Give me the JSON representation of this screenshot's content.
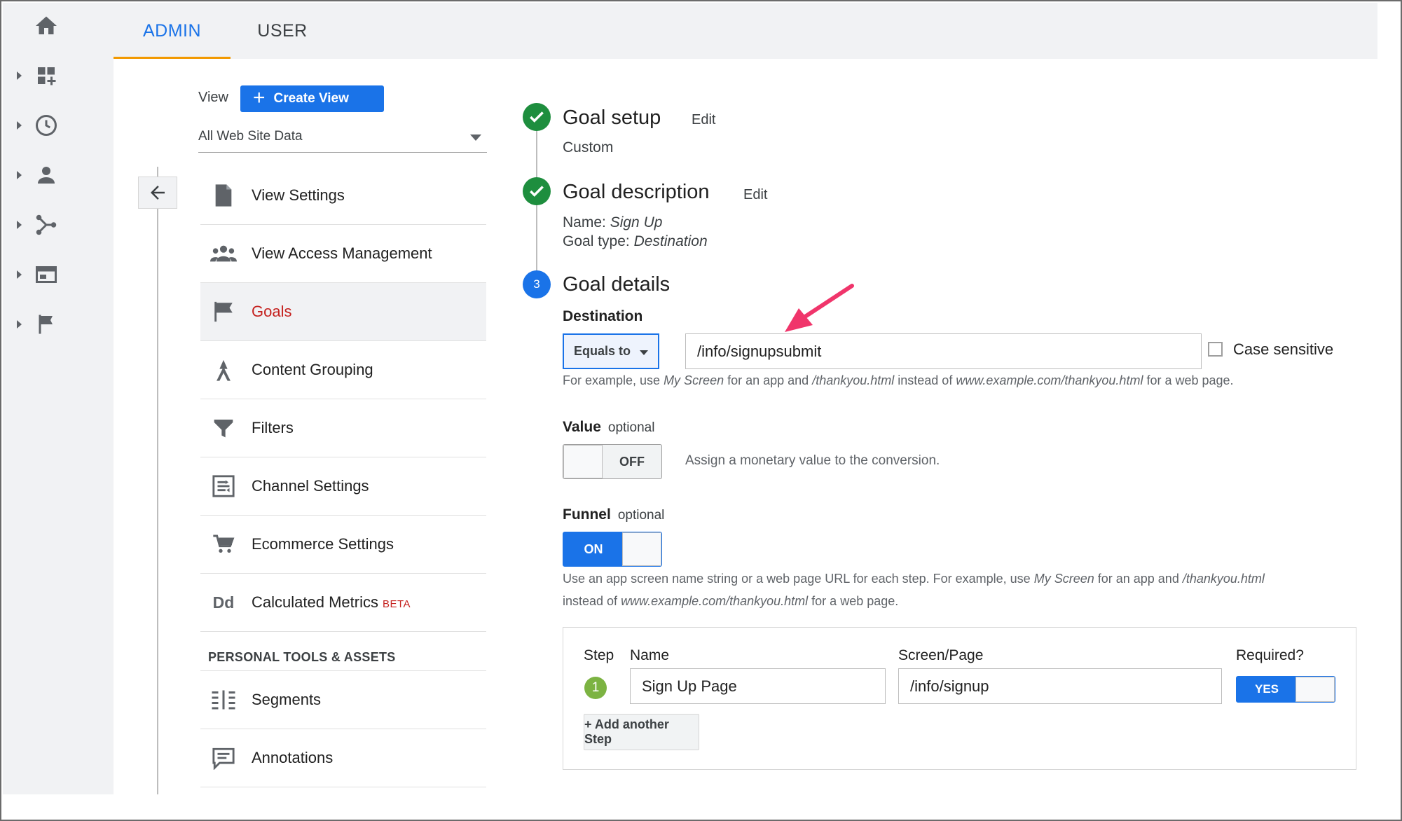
{
  "tabs": {
    "admin": "ADMIN",
    "user": "USER"
  },
  "view": {
    "label": "View",
    "create_button": "Create View",
    "selected": "All Web Site Data"
  },
  "nav": {
    "items": [
      {
        "label": "View Settings",
        "icon": "document-icon"
      },
      {
        "label": "View Access Management",
        "icon": "people-icon"
      },
      {
        "label": "Goals",
        "icon": "flag-icon",
        "active": true
      },
      {
        "label": "Content Grouping",
        "icon": "content-grouping-icon"
      },
      {
        "label": "Filters",
        "icon": "filter-icon"
      },
      {
        "label": "Channel Settings",
        "icon": "channel-settings-icon"
      },
      {
        "label": "Ecommerce Settings",
        "icon": "cart-icon"
      },
      {
        "label": "Calculated Metrics",
        "badge": "BETA",
        "icon": "dd-icon",
        "icon_text": "Dd"
      }
    ],
    "section_heading": "PERSONAL TOOLS & ASSETS",
    "personal": [
      {
        "label": "Segments",
        "icon": "segments-icon"
      },
      {
        "label": "Annotations",
        "icon": "annotations-icon"
      }
    ]
  },
  "goal_setup": {
    "title": "Goal setup",
    "edit": "Edit",
    "value": "Custom"
  },
  "goal_description": {
    "title": "Goal description",
    "edit": "Edit",
    "name_label": "Name:",
    "name_value": "Sign Up",
    "type_label": "Goal type:",
    "type_value": "Destination"
  },
  "goal_details": {
    "step_number": "3",
    "title": "Goal details",
    "destination": {
      "label": "Destination",
      "match_type": "Equals to",
      "value": "/info/signupsubmit",
      "case_sensitive_label": "Case sensitive",
      "case_sensitive": false,
      "help": {
        "p1": "For example, use ",
        "ex1": "My Screen",
        "p2": " for an app and ",
        "ex2": "/thankyou.html",
        "p3": " instead of ",
        "ex3": "www.example.com/thankyou.html",
        "p4": " for a web page."
      }
    },
    "value": {
      "label": "Value",
      "optional": "optional",
      "toggle": "OFF",
      "description": "Assign a monetary value to the conversion."
    },
    "funnel": {
      "label": "Funnel",
      "optional": "optional",
      "toggle": "ON",
      "help": {
        "p1": "Use an app screen name string or a web page URL for each step. For example, use ",
        "ex1": "My Screen",
        "p2": " for an app and ",
        "ex2": "/thankyou.html",
        "p3": "instead of ",
        "ex3": "www.example.com/thankyou.html",
        "p4": " for a web page."
      },
      "columns": {
        "step": "Step",
        "name": "Name",
        "screen": "Screen/Page",
        "required": "Required?"
      },
      "steps": [
        {
          "number": "1",
          "name": "Sign Up Page",
          "screen": "/info/signup",
          "required": "YES"
        }
      ],
      "add_step": "+ Add another Step"
    }
  },
  "colors": {
    "accent": "#1a73e8",
    "active_nav": "#c5221f",
    "success": "#1e8e3e",
    "tab_underline": "#f29900",
    "annotation_arrow": "#f0356b"
  }
}
